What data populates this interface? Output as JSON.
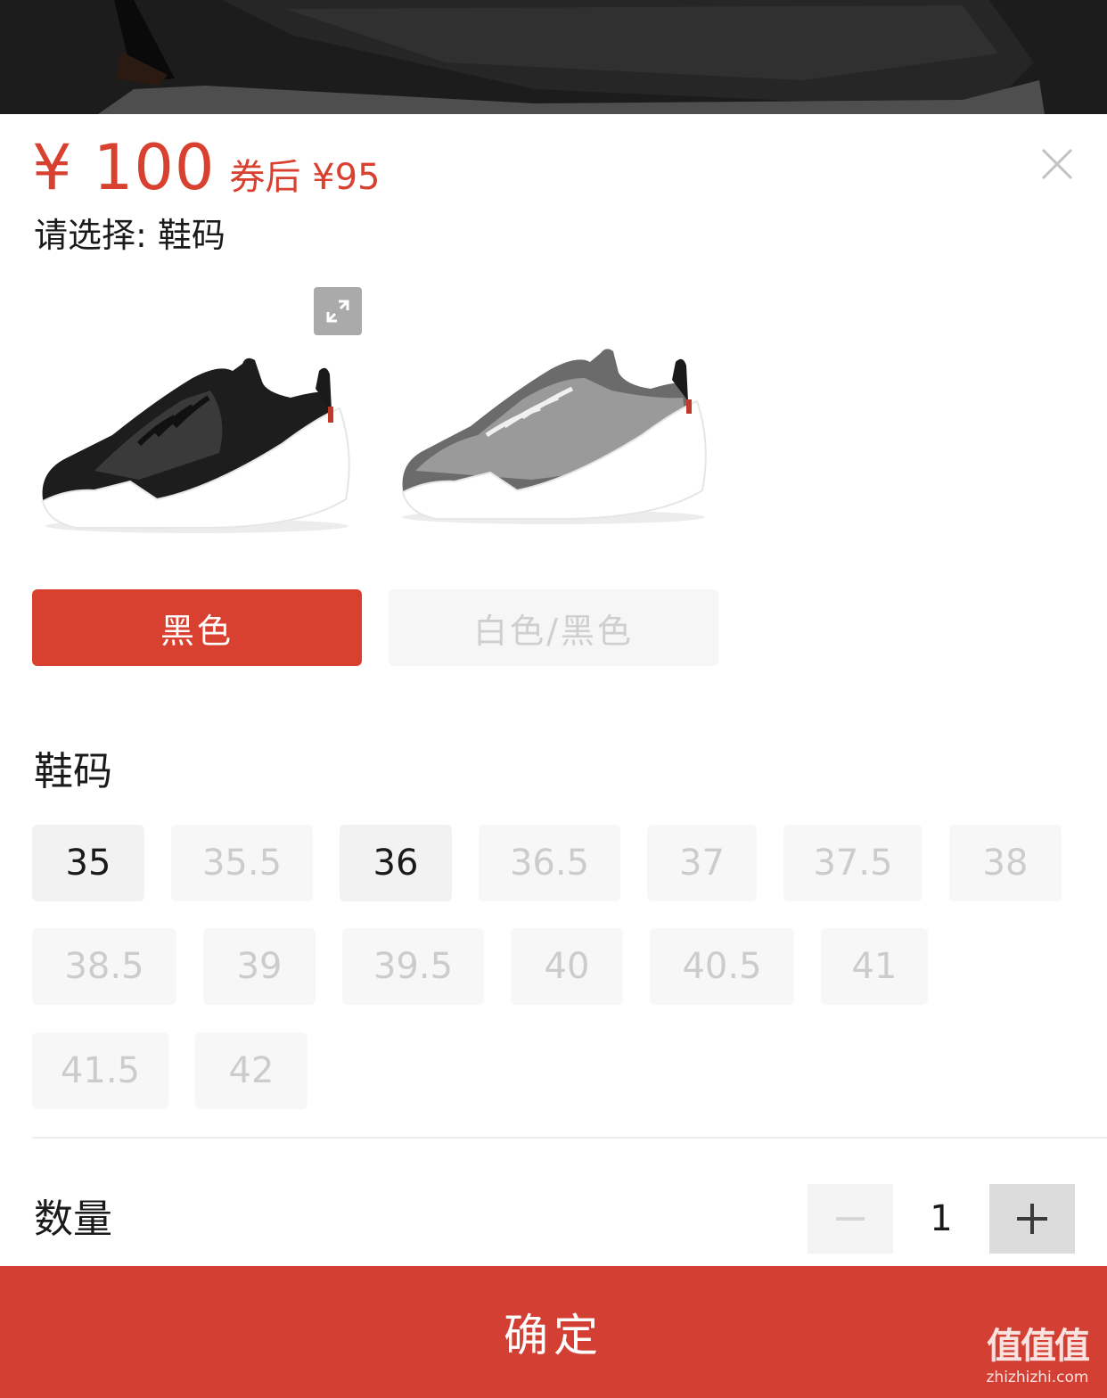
{
  "price": {
    "main": "¥ 100",
    "coupon": "券后 ¥95"
  },
  "prompt": "请选择: 鞋码",
  "color_options": [
    {
      "label": "黑色",
      "selected": true
    },
    {
      "label": "白色/黑色",
      "selected": false,
      "available": false
    }
  ],
  "size_section": {
    "title": "鞋码",
    "sizes": [
      {
        "label": "35",
        "available": true
      },
      {
        "label": "35.5",
        "available": false
      },
      {
        "label": "36",
        "available": true
      },
      {
        "label": "36.5",
        "available": false
      },
      {
        "label": "37",
        "available": false
      },
      {
        "label": "37.5",
        "available": false
      },
      {
        "label": "38",
        "available": false
      },
      {
        "label": "38.5",
        "available": false
      },
      {
        "label": "39",
        "available": false
      },
      {
        "label": "39.5",
        "available": false
      },
      {
        "label": "40",
        "available": false
      },
      {
        "label": "40.5",
        "available": false
      },
      {
        "label": "41",
        "available": false
      },
      {
        "label": "41.5",
        "available": false
      },
      {
        "label": "42",
        "available": false
      }
    ]
  },
  "quantity": {
    "label": "数量",
    "value": "1"
  },
  "confirm_label": "确定",
  "watermark": {
    "logo": "值值值",
    "url": "zhizhizhi.com"
  },
  "icons": {
    "close": "close-icon",
    "expand": "expand-icon",
    "minus": "minus-icon",
    "plus": "plus-icon"
  },
  "colors": {
    "accent": "#d8402f",
    "confirm_bg": "#d33f32",
    "chip_bg": "#f2f2f2",
    "disabled_text": "#cccccc"
  }
}
